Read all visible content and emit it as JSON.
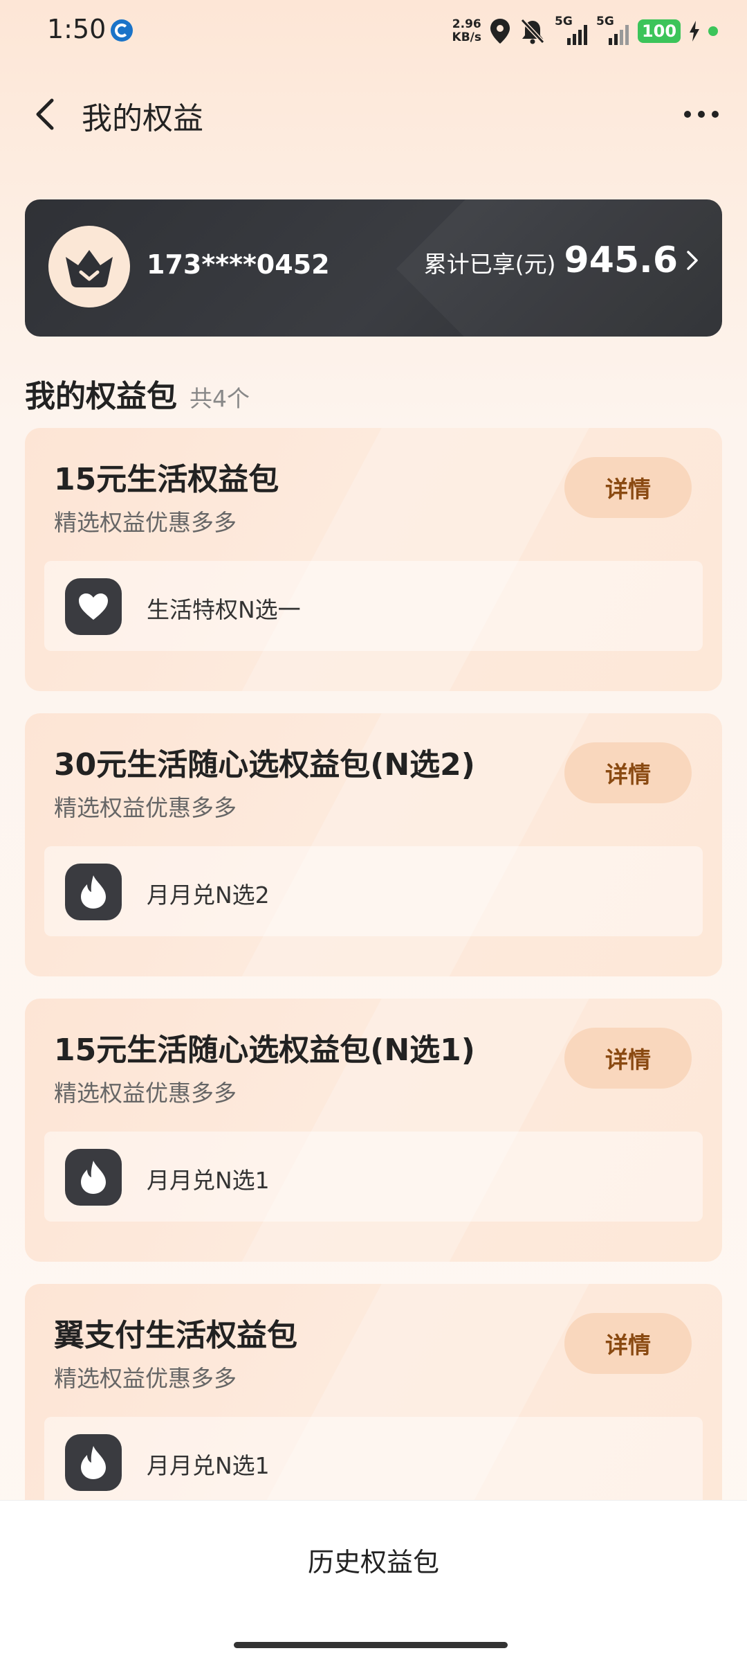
{
  "status_bar": {
    "time": "1:50",
    "speed_top": "2.96",
    "speed_bottom": "KB/s",
    "net1": "5G",
    "net2": "5G",
    "battery": "100",
    "icons": [
      "app-notification-icon",
      "location-icon",
      "mute-bell-icon",
      "signal-icon",
      "charging-icon"
    ]
  },
  "header": {
    "title": "我的权益",
    "back_icon": "chevron-left-icon",
    "more_icon": "more-dots-icon"
  },
  "member": {
    "phone": "173****0452",
    "total_label": "累计已享(元)",
    "total_value": "945.6",
    "avatar_icon": "crown-basket-icon"
  },
  "section": {
    "title": "我的权益包",
    "count": "共4个"
  },
  "packages": [
    {
      "title": "15元生活权益包",
      "subtitle": "精选权益优惠多多",
      "button": "详情",
      "benefit": "生活特权N选一",
      "benefit_icon": "heart-icon"
    },
    {
      "title": "30元生活随心选权益包(N选2)",
      "subtitle": "精选权益优惠多多",
      "button": "详情",
      "benefit": "月月兑N选2",
      "benefit_icon": "flame-icon"
    },
    {
      "title": "15元生活随心选权益包(N选1)",
      "subtitle": "精选权益优惠多多",
      "button": "详情",
      "benefit": "月月兑N选1",
      "benefit_icon": "flame-icon"
    },
    {
      "title": "翼支付生活权益包",
      "subtitle": "精选权益优惠多多",
      "button": "详情",
      "benefit": "月月兑N选1",
      "benefit_icon": "flame-icon"
    }
  ],
  "bottom": {
    "history_label": "历史权益包"
  },
  "colors": {
    "card_dark": "#2f3136",
    "detail_btn_bg": "#f9d7bd",
    "detail_btn_text": "#8a4a12",
    "battery_green": "#3cc45a"
  }
}
